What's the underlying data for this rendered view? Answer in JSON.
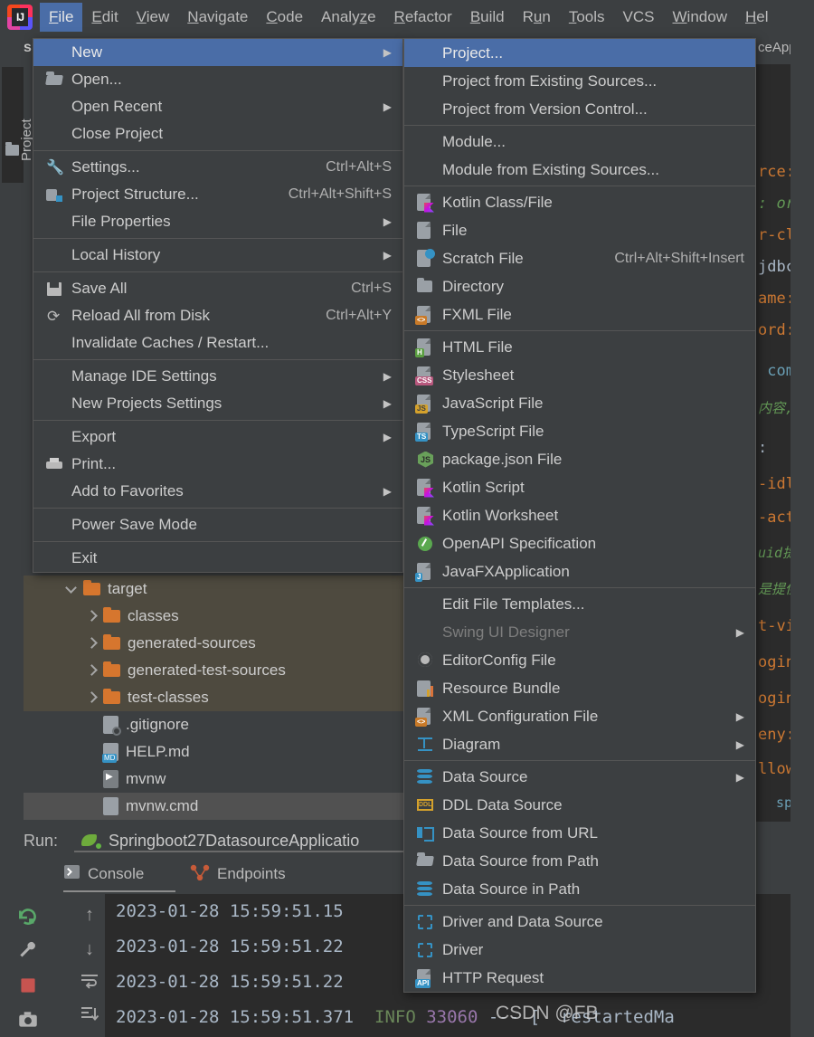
{
  "app": {
    "logo_initials": "IJ",
    "project_name": "spr",
    "tool_window_tab": "Project"
  },
  "menubar": {
    "items": [
      {
        "label": "File",
        "mnemonic": "F",
        "active": true
      },
      {
        "label": "Edit",
        "mnemonic": "E",
        "active": false
      },
      {
        "label": "View",
        "mnemonic": "V",
        "active": false
      },
      {
        "label": "Navigate",
        "mnemonic": "N",
        "active": false
      },
      {
        "label": "Code",
        "mnemonic": "C",
        "active": false
      },
      {
        "label": "Analyze",
        "mnemonic": "z",
        "active": false
      },
      {
        "label": "Refactor",
        "mnemonic": "R",
        "active": false
      },
      {
        "label": "Build",
        "mnemonic": "B",
        "active": false
      },
      {
        "label": "Run",
        "mnemonic": "u",
        "active": false
      },
      {
        "label": "Tools",
        "mnemonic": "T",
        "active": false
      },
      {
        "label": "VCS",
        "mnemonic": "",
        "active": false
      },
      {
        "label": "Window",
        "mnemonic": "W",
        "active": false
      },
      {
        "label": "Hel",
        "mnemonic": "H",
        "active": false
      }
    ]
  },
  "file_menu": {
    "items": [
      {
        "label": "New",
        "icon": "none",
        "shortcut": "",
        "arrow": true,
        "highlighted": true
      },
      {
        "label": "Open...",
        "icon": "open-folder",
        "shortcut": "",
        "arrow": false,
        "highlighted": false
      },
      {
        "label": "Open Recent",
        "icon": "none",
        "shortcut": "",
        "arrow": true,
        "highlighted": false
      },
      {
        "label": "Close Project",
        "icon": "none",
        "shortcut": "",
        "arrow": false,
        "highlighted": false
      },
      {
        "separator": true
      },
      {
        "label": "Settings...",
        "icon": "wrench",
        "shortcut": "Ctrl+Alt+S",
        "arrow": false,
        "highlighted": false
      },
      {
        "label": "Project Structure...",
        "icon": "project-structure",
        "shortcut": "Ctrl+Alt+Shift+S",
        "arrow": false,
        "highlighted": false
      },
      {
        "label": "File Properties",
        "icon": "none",
        "shortcut": "",
        "arrow": true,
        "highlighted": false
      },
      {
        "separator": true
      },
      {
        "label": "Local History",
        "icon": "none",
        "shortcut": "",
        "arrow": true,
        "highlighted": false
      },
      {
        "separator": true
      },
      {
        "label": "Save All",
        "icon": "save",
        "shortcut": "Ctrl+S",
        "arrow": false,
        "highlighted": false
      },
      {
        "label": "Reload All from Disk",
        "icon": "reload",
        "shortcut": "Ctrl+Alt+Y",
        "arrow": false,
        "highlighted": false
      },
      {
        "label": "Invalidate Caches / Restart...",
        "icon": "none",
        "shortcut": "",
        "arrow": false,
        "highlighted": false
      },
      {
        "separator": true
      },
      {
        "label": "Manage IDE Settings",
        "icon": "none",
        "shortcut": "",
        "arrow": true,
        "highlighted": false
      },
      {
        "label": "New Projects Settings",
        "icon": "none",
        "shortcut": "",
        "arrow": true,
        "highlighted": false
      },
      {
        "separator": true
      },
      {
        "label": "Export",
        "icon": "none",
        "shortcut": "",
        "arrow": true,
        "highlighted": false
      },
      {
        "label": "Print...",
        "icon": "printer",
        "shortcut": "",
        "arrow": false,
        "highlighted": false
      },
      {
        "label": "Add to Favorites",
        "icon": "none",
        "shortcut": "",
        "arrow": true,
        "highlighted": false
      },
      {
        "separator": true
      },
      {
        "label": "Power Save Mode",
        "icon": "none",
        "shortcut": "",
        "arrow": false,
        "highlighted": false
      },
      {
        "separator": true
      },
      {
        "label": "Exit",
        "icon": "none",
        "shortcut": "",
        "arrow": false,
        "highlighted": false
      }
    ]
  },
  "new_submenu": {
    "items": [
      {
        "label": "Project...",
        "icon": "none",
        "shortcut": "",
        "arrow": false,
        "highlighted": true,
        "disabled": false
      },
      {
        "label": "Project from Existing Sources...",
        "icon": "none",
        "shortcut": "",
        "arrow": false,
        "highlighted": false,
        "disabled": false
      },
      {
        "label": "Project from Version Control...",
        "icon": "none",
        "shortcut": "",
        "arrow": false,
        "highlighted": false,
        "disabled": false
      },
      {
        "separator": true
      },
      {
        "label": "Module...",
        "icon": "none",
        "shortcut": "",
        "arrow": false,
        "highlighted": false,
        "disabled": false
      },
      {
        "label": "Module from Existing Sources...",
        "icon": "none",
        "shortcut": "",
        "arrow": false,
        "highlighted": false,
        "disabled": false
      },
      {
        "separator": true
      },
      {
        "label": "Kotlin Class/File",
        "icon": "kotlin-file",
        "shortcut": "",
        "arrow": false,
        "highlighted": false,
        "disabled": false
      },
      {
        "label": "File",
        "icon": "file",
        "shortcut": "",
        "arrow": false,
        "highlighted": false,
        "disabled": false
      },
      {
        "label": "Scratch File",
        "icon": "scratch-file",
        "shortcut": "Ctrl+Alt+Shift+Insert",
        "arrow": false,
        "highlighted": false,
        "disabled": false
      },
      {
        "label": "Directory",
        "icon": "directory",
        "shortcut": "",
        "arrow": false,
        "highlighted": false,
        "disabled": false
      },
      {
        "label": "FXML File",
        "icon": "fxml-file",
        "shortcut": "",
        "arrow": false,
        "highlighted": false,
        "disabled": false
      },
      {
        "separator": true
      },
      {
        "label": "HTML File",
        "icon": "html-file",
        "shortcut": "",
        "arrow": false,
        "highlighted": false,
        "disabled": false
      },
      {
        "label": "Stylesheet",
        "icon": "css-file",
        "shortcut": "",
        "arrow": false,
        "highlighted": false,
        "disabled": false
      },
      {
        "label": "JavaScript File",
        "icon": "js-file",
        "shortcut": "",
        "arrow": false,
        "highlighted": false,
        "disabled": false
      },
      {
        "label": "TypeScript File",
        "icon": "ts-file",
        "shortcut": "",
        "arrow": false,
        "highlighted": false,
        "disabled": false
      },
      {
        "label": "package.json File",
        "icon": "npm-file",
        "shortcut": "",
        "arrow": false,
        "highlighted": false,
        "disabled": false
      },
      {
        "label": "Kotlin Script",
        "icon": "kotlin-script",
        "shortcut": "",
        "arrow": false,
        "highlighted": false,
        "disabled": false
      },
      {
        "label": "Kotlin Worksheet",
        "icon": "kotlin-worksheet",
        "shortcut": "",
        "arrow": false,
        "highlighted": false,
        "disabled": false
      },
      {
        "label": "OpenAPI Specification",
        "icon": "openapi",
        "shortcut": "",
        "arrow": false,
        "highlighted": false,
        "disabled": false
      },
      {
        "label": "JavaFXApplication",
        "icon": "javafx-file",
        "shortcut": "",
        "arrow": false,
        "highlighted": false,
        "disabled": false
      },
      {
        "separator": true
      },
      {
        "label": "Edit File Templates...",
        "icon": "none",
        "shortcut": "",
        "arrow": false,
        "highlighted": false,
        "disabled": false
      },
      {
        "label": "Swing UI Designer",
        "icon": "none",
        "shortcut": "",
        "arrow": true,
        "highlighted": false,
        "disabled": true
      },
      {
        "label": "EditorConfig File",
        "icon": "gear",
        "shortcut": "",
        "arrow": false,
        "highlighted": false,
        "disabled": false
      },
      {
        "label": "Resource Bundle",
        "icon": "resource-bundle",
        "shortcut": "",
        "arrow": false,
        "highlighted": false,
        "disabled": false
      },
      {
        "label": "XML Configuration File",
        "icon": "xml-file",
        "shortcut": "",
        "arrow": true,
        "highlighted": false,
        "disabled": false
      },
      {
        "label": "Diagram",
        "icon": "diagram",
        "shortcut": "",
        "arrow": true,
        "highlighted": false,
        "disabled": false
      },
      {
        "separator": true
      },
      {
        "label": "Data Source",
        "icon": "database",
        "shortcut": "",
        "arrow": true,
        "highlighted": false,
        "disabled": false
      },
      {
        "label": "DDL Data Source",
        "icon": "ddl",
        "shortcut": "",
        "arrow": false,
        "highlighted": false,
        "disabled": false
      },
      {
        "label": "Data Source from URL",
        "icon": "plug",
        "shortcut": "",
        "arrow": false,
        "highlighted": false,
        "disabled": false
      },
      {
        "label": "Data Source from Path",
        "icon": "open-folder",
        "shortcut": "",
        "arrow": false,
        "highlighted": false,
        "disabled": false
      },
      {
        "label": "Data Source in Path",
        "icon": "database",
        "shortcut": "",
        "arrow": false,
        "highlighted": false,
        "disabled": false
      },
      {
        "separator": true
      },
      {
        "label": "Driver and Data Source",
        "icon": "driver",
        "shortcut": "",
        "arrow": false,
        "highlighted": false,
        "disabled": false
      },
      {
        "label": "Driver",
        "icon": "driver",
        "shortcut": "",
        "arrow": false,
        "highlighted": false,
        "disabled": false
      },
      {
        "label": "HTTP Request",
        "icon": "http-file",
        "shortcut": "",
        "arrow": false,
        "highlighted": false,
        "disabled": false
      }
    ]
  },
  "project_tree": {
    "rows": [
      {
        "label": "target",
        "indent": 2,
        "icon": "folder",
        "chevron": "down",
        "selected": true
      },
      {
        "label": "classes",
        "indent": 3,
        "icon": "folder",
        "chevron": "right",
        "selected": true
      },
      {
        "label": "generated-sources",
        "indent": 3,
        "icon": "folder",
        "chevron": "right",
        "selected": true
      },
      {
        "label": "generated-test-sources",
        "indent": 3,
        "icon": "folder",
        "chevron": "right",
        "selected": true
      },
      {
        "label": "test-classes",
        "indent": 3,
        "icon": "folder",
        "chevron": "right",
        "selected": true
      },
      {
        "label": ".gitignore",
        "indent": 3,
        "icon": "gitignore-file",
        "chevron": "",
        "selected": false
      },
      {
        "label": "HELP.md",
        "indent": 3,
        "icon": "md-file",
        "chevron": "",
        "selected": false
      },
      {
        "label": "mvnw",
        "indent": 3,
        "icon": "run-file",
        "chevron": "",
        "selected": false
      },
      {
        "label": "mvnw.cmd",
        "indent": 3,
        "icon": "cmd-file",
        "chevron": "",
        "selected": false
      }
    ]
  },
  "run_panel": {
    "title_label": "Run:",
    "config_name": "Springboot27DatasourceApplicatio",
    "tabs": [
      {
        "label": "Console",
        "icon": "console-icon",
        "selected": true
      },
      {
        "label": "Endpoints",
        "icon": "endpoints-icon",
        "selected": false
      }
    ],
    "side_buttons": [
      "rerun-icon",
      "settings-wrench-icon",
      "stop-icon",
      "camera-icon",
      "debug-icon"
    ],
    "console_buttons": [
      "up-arrow-icon",
      "down-arrow-icon",
      "soft-wrap-icon",
      "scroll-to-end-icon"
    ],
    "console_lines": [
      {
        "ts": "2023-01-28 15:59:51.15",
        "level": "",
        "pid": "",
        "rest": ""
      },
      {
        "ts": "2023-01-28 15:59:51.22",
        "level": "",
        "pid": "",
        "rest": ""
      },
      {
        "ts": "2023-01-28 15:59:51.22",
        "level": "",
        "pid": "",
        "rest": ""
      },
      {
        "ts": "2023-01-28 15:59:51.371",
        "level": "INFO",
        "pid": "33060",
        "rest": "--- [  restartedMa"
      }
    ]
  },
  "editor": {
    "tab_label": "ceApplic",
    "code_fragments": [
      "rce:",
      ": org",
      "r-cla",
      "jdbc:",
      "ame:",
      "ord:",
      " com.",
      "内容, p",
      ":",
      "-idle",
      "-activ",
      "uid提",
      "是提供",
      "t-vie",
      "ogin-",
      "ogin-",
      "eny:",
      "llow:",
      "sprin"
    ]
  },
  "watermark": {
    "text": "CSDN @FB"
  },
  "colors": {
    "menu_bg": "#3c3f41",
    "highlight": "#4a6da7",
    "editor_bg": "#2b2b2b",
    "text": "#cdcdcd",
    "accent_green": "#00df7d",
    "folder_orange": "#d6762e"
  }
}
